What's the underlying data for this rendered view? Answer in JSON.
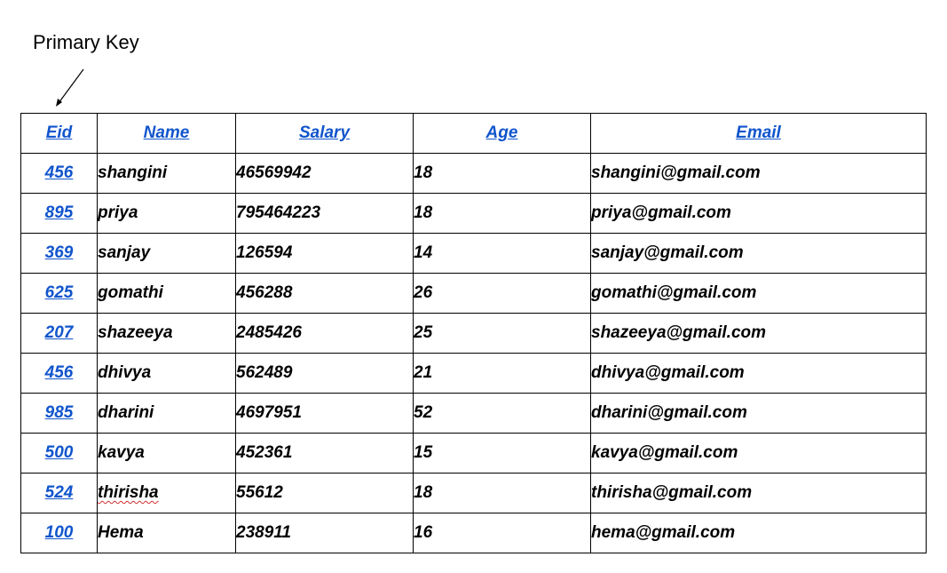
{
  "annotation": {
    "label": "Primary Key"
  },
  "table": {
    "headers": [
      "Eid",
      "Name",
      "Salary",
      "Age",
      "Email"
    ],
    "rows": [
      {
        "eid": "456",
        "name": "shangini",
        "salary": "46569942",
        "age": "18",
        "email": "shangini@gmail.com"
      },
      {
        "eid": "895",
        "name": "priya",
        "salary": "795464223",
        "age": "18",
        "email": "priya@gmail.com"
      },
      {
        "eid": "369",
        "name": "sanjay",
        "salary": "126594",
        "age": "14",
        "email": "sanjay@gmail.com"
      },
      {
        "eid": "625",
        "name": "gomathi",
        "salary": "456288",
        "age": "26",
        "email": "gomathi@gmail.com"
      },
      {
        "eid": "207",
        "name": "shazeeya",
        "salary": "2485426",
        "age": "25",
        "email": "shazeeya@gmail.com"
      },
      {
        "eid": "456",
        "name": "dhivya",
        "salary": "562489",
        "age": "21",
        "email": "dhivya@gmail.com"
      },
      {
        "eid": "985",
        "name": "dharini",
        "salary": "4697951",
        "age": "52",
        "email": "dharini@gmail.com"
      },
      {
        "eid": "500",
        "name": "kavya",
        "salary": "452361",
        "age": "15",
        "email": "kavya@gmail.com"
      },
      {
        "eid": "524",
        "name": "thirisha",
        "salary": "55612",
        "age": "18",
        "email": "thirisha@gmail.com"
      },
      {
        "eid": "100",
        "name": "Hema",
        "salary": "238911",
        "age": "16",
        "email": "hema@gmail.com"
      }
    ]
  },
  "colors": {
    "header_link": "#1155cc",
    "text": "#000000",
    "border": "#000000",
    "spellcheck": "#d32f2f"
  }
}
